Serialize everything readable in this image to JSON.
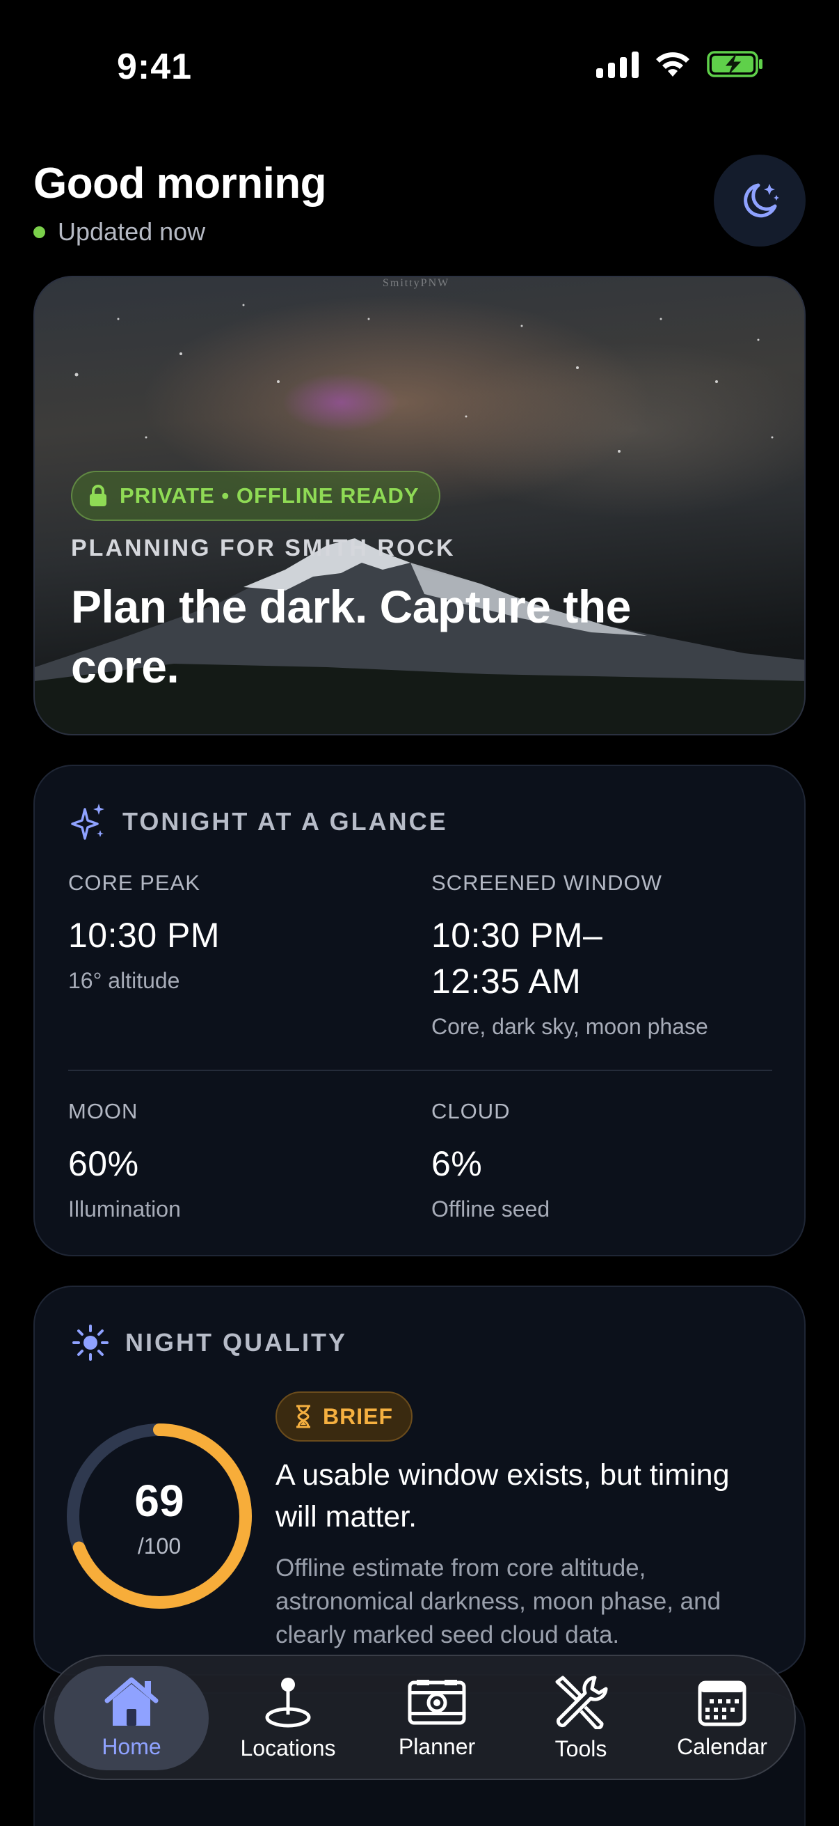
{
  "status_bar": {
    "time": "9:41"
  },
  "header": {
    "greeting": "Good morning",
    "updated": "Updated now"
  },
  "hero": {
    "watermark": "SmittyPNW",
    "badge": "PRIVATE • OFFLINE READY",
    "subtitle": "PLANNING FOR SMITH ROCK",
    "title": "Plan the dark. Capture the core."
  },
  "glance": {
    "heading": "TONIGHT AT A GLANCE",
    "core_peak": {
      "label": "CORE PEAK",
      "value": "10:30 PM",
      "sub": "16° altitude"
    },
    "window": {
      "label": "SCREENED WINDOW",
      "value_line1": "10:30 PM–",
      "value_line2": "12:35 AM",
      "sub": "Core, dark sky, moon phase"
    },
    "moon": {
      "label": "MOON",
      "value": "60%",
      "sub": "Illumination"
    },
    "cloud": {
      "label": "CLOUD",
      "value": "6%",
      "sub": "Offline seed"
    }
  },
  "night_quality": {
    "heading": "NIGHT QUALITY",
    "score": "69",
    "score_max": "/100",
    "score_fraction": 0.69,
    "badge": "BRIEF",
    "summary": "A usable window exists, but timing will matter.",
    "detail": "Offline estimate from core altitude, astronomical darkness, moon phase, and clearly marked seed cloud data.",
    "colors": {
      "gauge": "#f7ad3a",
      "track": "#2f394f"
    }
  },
  "tabs": [
    {
      "label": "Home",
      "icon": "house-icon",
      "active": true
    },
    {
      "label": "Locations",
      "icon": "map-pin-icon",
      "active": false
    },
    {
      "label": "Planner",
      "icon": "planner-icon",
      "active": false
    },
    {
      "label": "Tools",
      "icon": "tools-icon",
      "active": false
    },
    {
      "label": "Calendar",
      "icon": "calendar-icon",
      "active": false
    }
  ],
  "colors": {
    "accent": "#8fa2ff",
    "green": "#8fdb55",
    "amber": "#f5b040"
  }
}
